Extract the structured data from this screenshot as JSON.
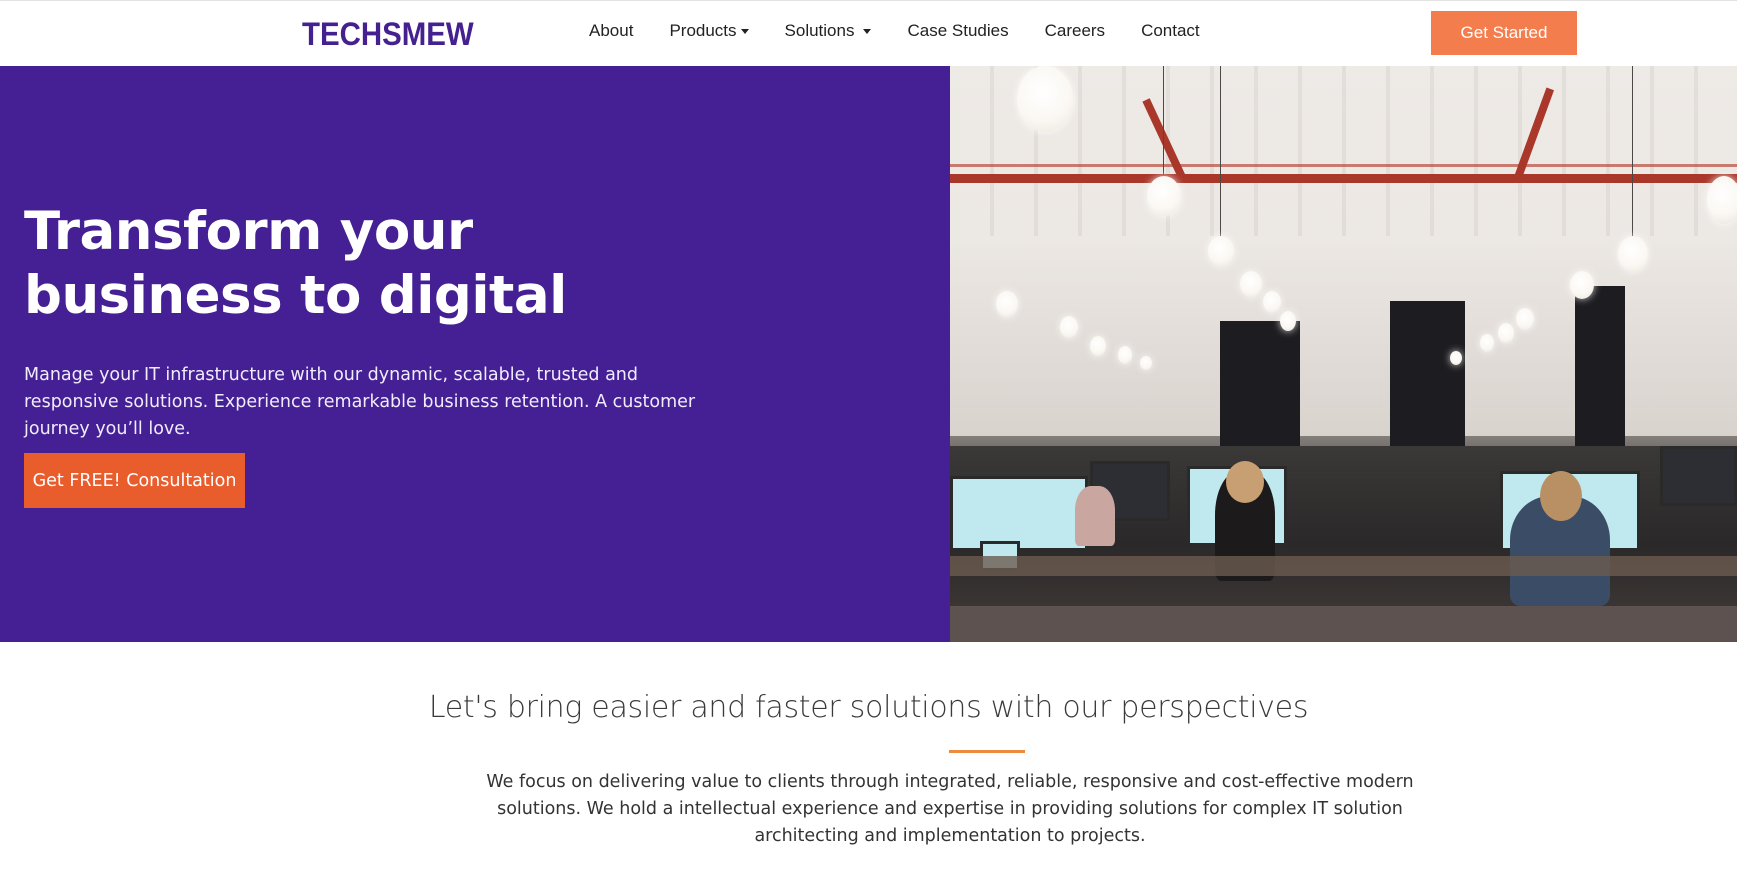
{
  "brand": {
    "logo_text": "TECHSMEW",
    "primary_color": "#452095",
    "accent_color": "#f47d4d"
  },
  "nav": {
    "items": [
      {
        "label": "About",
        "has_dropdown": false
      },
      {
        "label": "Products",
        "has_dropdown": true
      },
      {
        "label": "Solutions",
        "has_dropdown": true
      },
      {
        "label": "Case Studies",
        "has_dropdown": false
      },
      {
        "label": "Careers",
        "has_dropdown": false
      },
      {
        "label": "Contact",
        "has_dropdown": false
      }
    ],
    "cta_label": "Get Started"
  },
  "hero": {
    "title": "Transform your business to digital",
    "subtitle": "Manage your IT infrastructure with our dynamic, scalable, trusted and responsive solutions. Experience remarkable business retention. A customer journey you’ll love.",
    "cta_label": "Get FREE! Consultation",
    "image_alt": "office-photo"
  },
  "about": {
    "title": "Let's bring easier and faster solutions with our perspectives",
    "text": "We focus on delivering value to clients through integrated, reliable, responsive and cost-effective modern solutions. We hold a intellectual experience and expertise in providing solutions for complex IT solution architecting and implementation to projects."
  }
}
